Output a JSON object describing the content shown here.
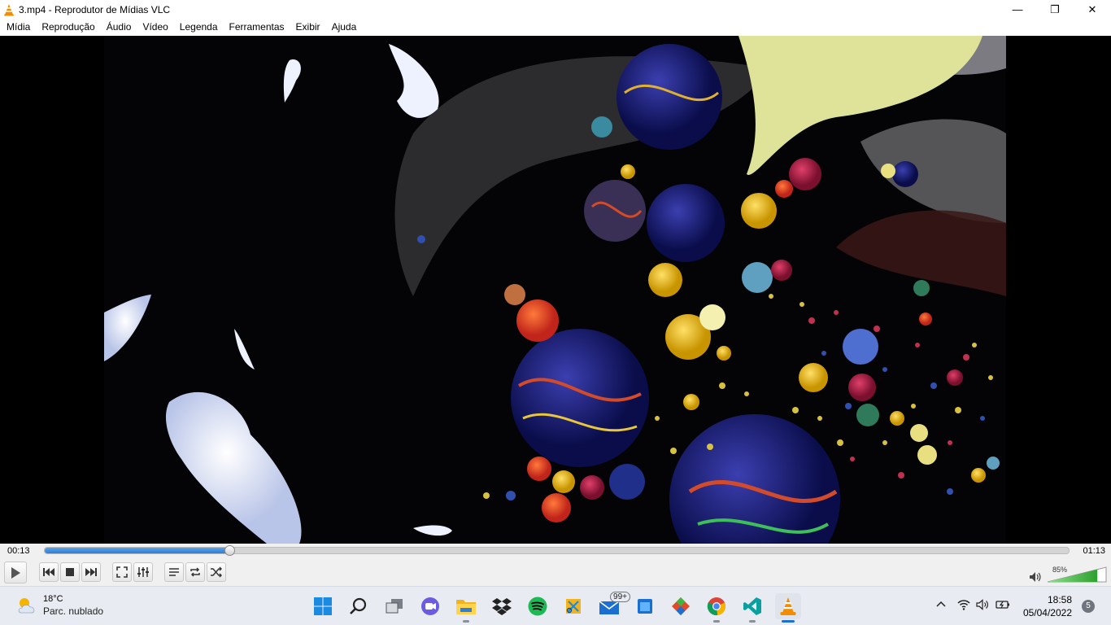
{
  "window": {
    "title": "3.mp4 - Reprodutor de Mídias VLC",
    "minimize_glyph": "—",
    "restore_glyph": "❐",
    "close_glyph": "✕"
  },
  "menu": {
    "items": [
      "Mídia",
      "Reprodução",
      "Áudio",
      "Vídeo",
      "Legenda",
      "Ferramentas",
      "Exibir",
      "Ajuda"
    ]
  },
  "video": {
    "file": "3.mp4"
  },
  "seek": {
    "elapsed": "00:13",
    "total": "01:13",
    "progress": 0.18
  },
  "controls": {
    "buttons": [
      "play",
      "previous",
      "stop",
      "next",
      "fullscreen",
      "extended-settings",
      "playlist",
      "loop",
      "random"
    ],
    "volume_label": "85%",
    "volume": 0.85
  },
  "taskbar": {
    "weather_temp": "18°C",
    "weather_condition": "Parc. nublado",
    "apps": [
      "start",
      "search",
      "task-view",
      "teams-chat",
      "file-explorer",
      "dropbox",
      "spotify",
      "snip-tool",
      "mail",
      "store",
      "git",
      "chrome",
      "vscode",
      "vlc"
    ],
    "mail_badge": "99+",
    "time": "18:58",
    "date": "05/04/2022",
    "notifications": "5"
  },
  "colors": {
    "accent": "#2f7fd6",
    "volume_green": "#3fb43f",
    "vlc_orange": "#f28c00"
  }
}
